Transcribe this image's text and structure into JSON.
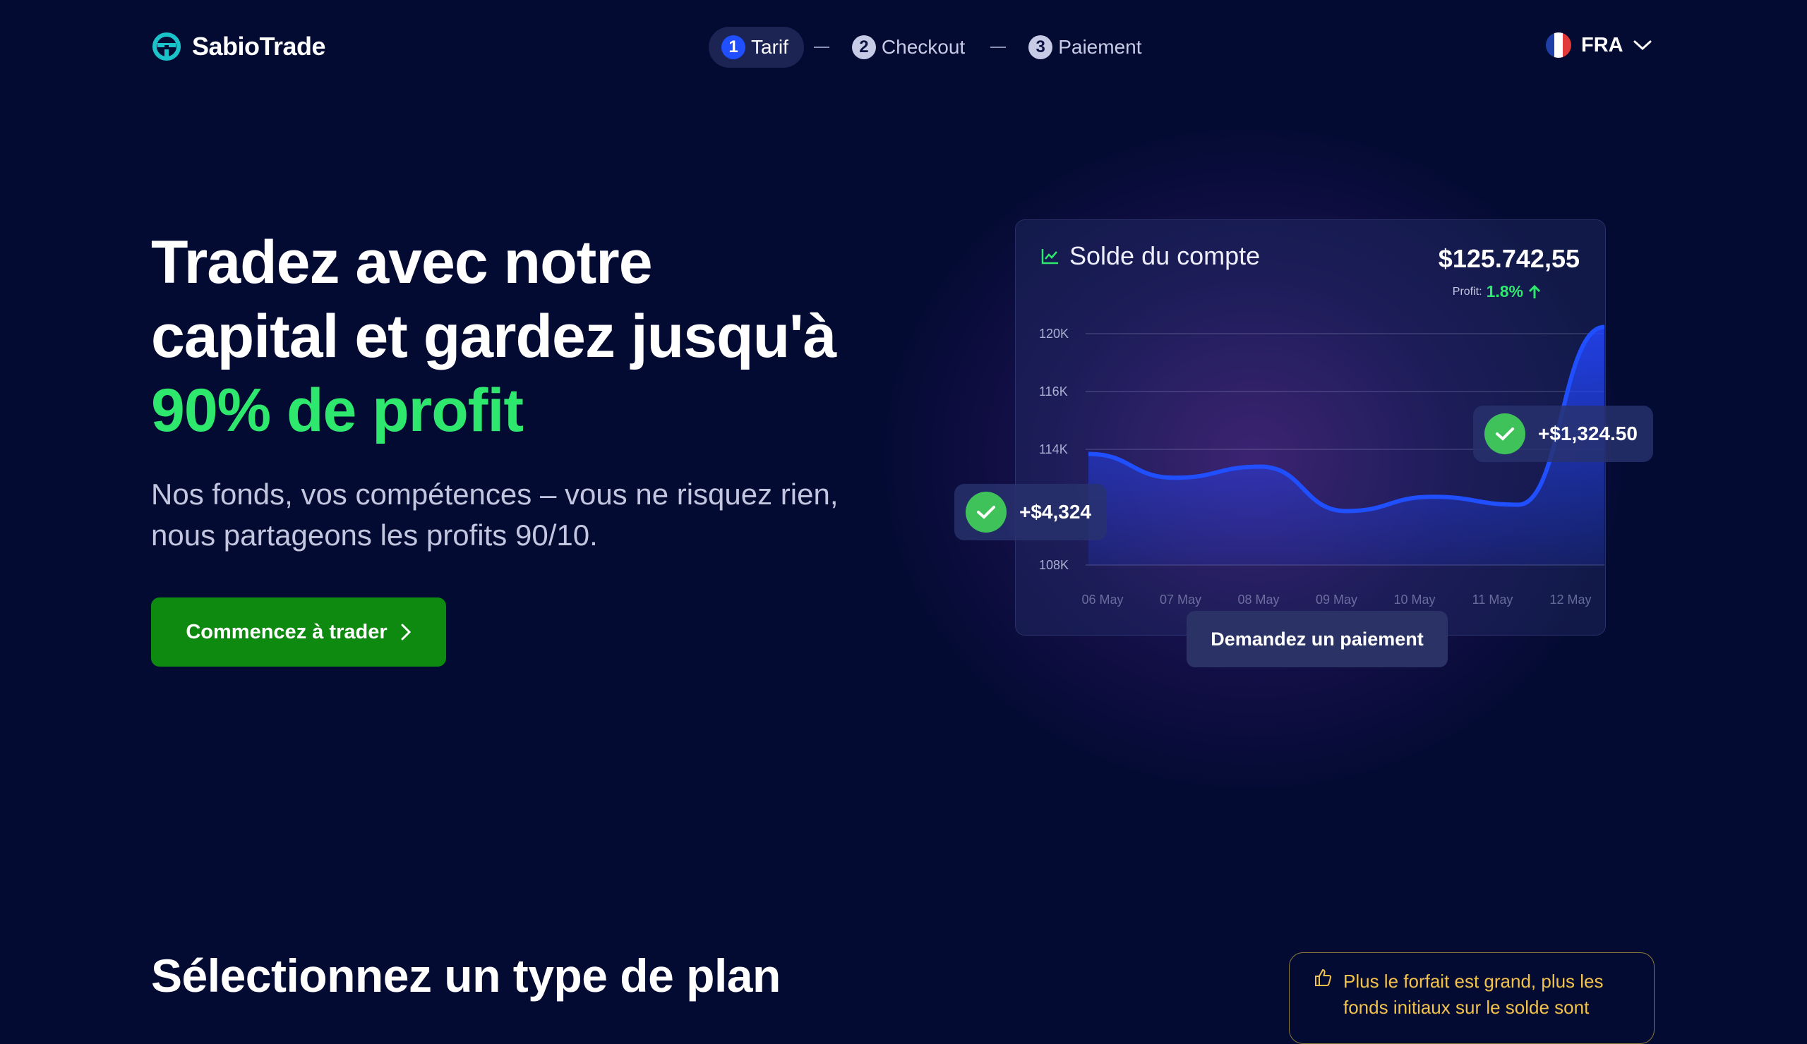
{
  "brand": {
    "name": "SabioTrade",
    "logo_icon": "sabiotrade-logo-icon",
    "accent": "#19c3c9"
  },
  "steps": [
    {
      "number": "1",
      "label": "Tarif",
      "active": true
    },
    {
      "number": "2",
      "label": "Checkout",
      "active": false
    },
    {
      "number": "3",
      "label": "Paiement",
      "active": false
    }
  ],
  "language": {
    "code": "FRA",
    "flag": "france-flag-icon"
  },
  "hero": {
    "title_line1": "Tradez avec notre",
    "title_line2": "capital et gardez jusqu'à",
    "title_highlight": "90% de profit",
    "subtitle": "Nos fonds, vos compétences – vous ne risquez rien, nous partageons les profits 90/10.",
    "cta_label": "Commencez à trader",
    "highlight_color": "#2ee86e",
    "cta_color": "#0f8a10"
  },
  "account_card": {
    "title": "Solde du compte",
    "balance": "$125.742,55",
    "profit_label": "Profit:",
    "profit_value": "1.8%",
    "badge_left": "+$4,324",
    "badge_right": "+$1,324.50",
    "payout_button": "Demandez un paiement"
  },
  "chart_data": {
    "type": "area",
    "x": [
      "06 May",
      "07 May",
      "08 May",
      "09 May",
      "10 May",
      "11 May",
      "12 May"
    ],
    "y_ticks": [
      "120K",
      "116K",
      "114K",
      "108K"
    ],
    "series": [
      {
        "values": [
          114,
          112.5,
          113.2,
          110.4,
          111.3,
          110.8,
          122
        ]
      }
    ],
    "line_color": "#1f4fff",
    "grid": true
  },
  "plans": {
    "title": "Sélectionnez un type de plan",
    "tip_text": "Plus le forfait est grand, plus les fonds initiaux sur le solde sont"
  }
}
